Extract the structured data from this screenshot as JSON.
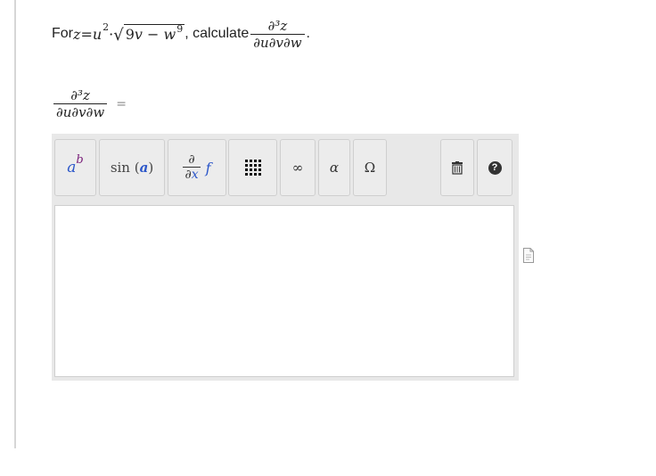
{
  "question": {
    "prefix": "For ",
    "z": "z",
    "equals": " = ",
    "u": "u",
    "u_exp": "2",
    "dot": " · ",
    "radicand_coef": "9",
    "v": "v",
    "minus": " − ",
    "w": "w",
    "w_exp": "9",
    "middle": ", calculate ",
    "deriv_num": "∂³z",
    "deriv_den": "∂u∂v∂w",
    "suffix": "."
  },
  "answer": {
    "deriv_num": "∂³z",
    "deriv_den": "∂u∂v∂w",
    "equals": "="
  },
  "toolbar": {
    "power_base": "a",
    "power_exp": "b",
    "sin_label": "sin",
    "sin_arg": "a",
    "deriv_top": "∂",
    "deriv_bottom_d": "∂",
    "deriv_bottom_x": "x",
    "deriv_f": "f",
    "infinity": "∞",
    "alpha": "α",
    "omega": "Ω",
    "help": "?"
  },
  "input": {
    "value": ""
  },
  "colors": {
    "variable_blue": "#2b56c9",
    "exponent_purple": "#7a1f7a",
    "toolbar_bg": "#e8e8e8"
  },
  "icons": [
    "matrix-icon",
    "trash-icon",
    "help-icon",
    "document-icon"
  ]
}
